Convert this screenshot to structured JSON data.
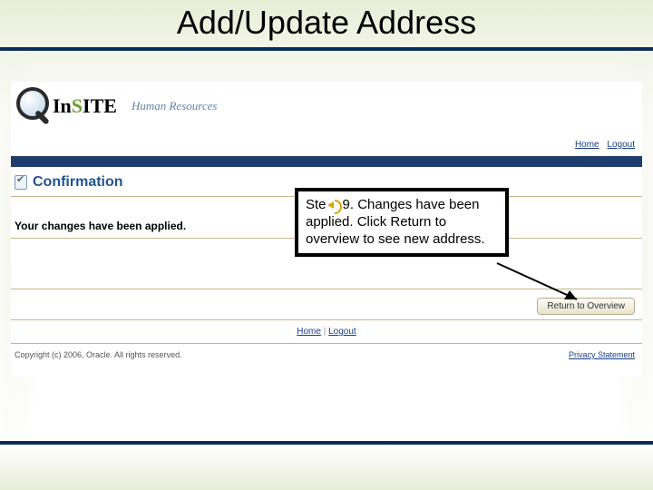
{
  "title": "Add/Update Address",
  "logo": {
    "part_in": "In",
    "part_s": "S",
    "part_ite": "ITE",
    "subtitle": "Human Resources"
  },
  "toplinks": {
    "home": "Home",
    "logout": "Logout"
  },
  "confirmation": {
    "heading": "Confirmation"
  },
  "message": "Your changes have been applied.",
  "buttons": {
    "return": "Return to Overview"
  },
  "footer": {
    "home": "Home",
    "logout": "Logout",
    "separator": " | ",
    "copyright": "Copyright (c) 2006, Oracle. All rights reserved.",
    "privacy": "Privacy Statement"
  },
  "callout": {
    "pre": "Ste",
    "post": "9. Changes have been applied. Click Return to overview to see new address."
  }
}
